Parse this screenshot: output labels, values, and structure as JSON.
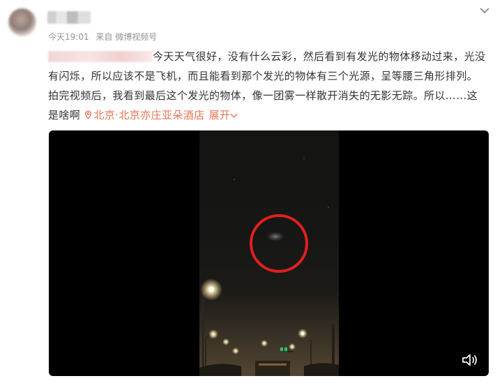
{
  "post": {
    "meta_time": "今天19:01",
    "meta_source": "来自 微博视频号",
    "text": "今天天气很好，没有什么云彩，然后看到有发光的物体移动过来，光没有闪烁，所以应该不是飞机，而且能看到那个发光的物体有三个光源，呈等腰三角形排列。拍完视频后，我看到最后这个发光的物体，像一团雾一样散开消失的无影无踪。所以……这是啥啊",
    "location": "北京·北京亦庄亚朵酒店",
    "expand_label": "展开"
  },
  "icons": {
    "menu": "chevron-down-icon",
    "location": "location-pin-icon",
    "expand": "chevron-down-icon",
    "sound": "speaker-icon"
  },
  "colors": {
    "accent": "#eb7350",
    "meta": "#939393",
    "highlight_circle": "#e0201f"
  }
}
